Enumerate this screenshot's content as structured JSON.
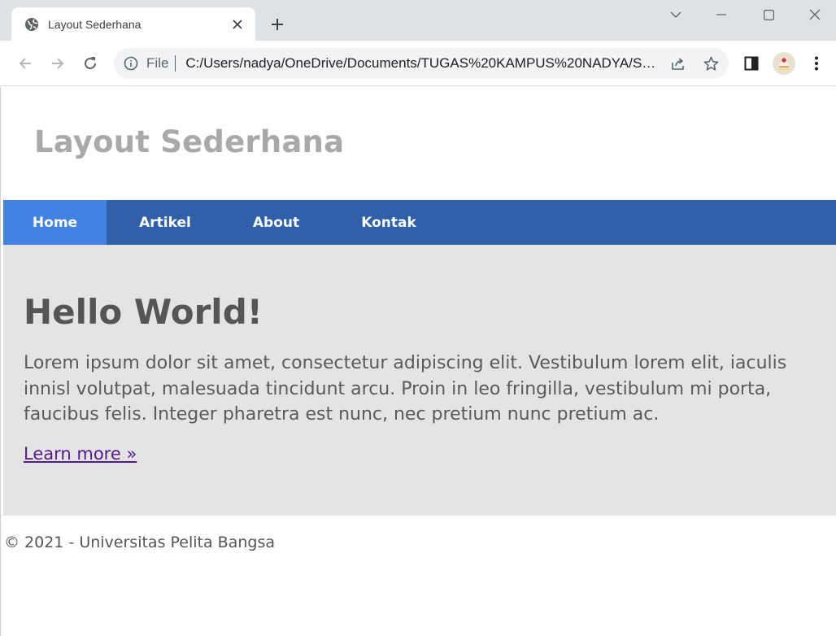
{
  "browser": {
    "tab": {
      "title": "Layout Sederhana"
    },
    "address": {
      "scheme_label": "File",
      "url": "C:/Users/nadya/OneDrive/Documents/TUGAS%20KAMPUS%20NADYA/SE..."
    },
    "icons": {
      "favicon": "globe-icon",
      "close": "close-icon",
      "new_tab": "plus-icon",
      "tab_search": "chevron-down-icon",
      "minimize": "minimize-icon",
      "maximize": "maximize-icon",
      "close_window": "close-window-icon",
      "back": "back-arrow-icon",
      "forward": "forward-arrow-icon",
      "reload": "reload-icon",
      "info": "info-icon",
      "share": "share-icon",
      "bookmark": "star-icon",
      "side_panel": "side-panel-icon",
      "profile": "avatar",
      "menu": "kebab-menu-icon"
    }
  },
  "page": {
    "header": {
      "title": "Layout Sederhana"
    },
    "nav": [
      {
        "label": "Home",
        "active": true
      },
      {
        "label": "Artikel",
        "active": false
      },
      {
        "label": "About",
        "active": false
      },
      {
        "label": "Kontak",
        "active": false
      }
    ],
    "hero": {
      "title": "Hello World!",
      "text": "Lorem ipsum dolor sit amet, consectetur adipiscing elit. Vestibulum lorem elit, iaculis innisl volutpat, malesuada tincidunt arcu. Proin in leo fringilla, vestibulum mi porta, faucibus felis. Integer pharetra est nunc, nec pretium nunc pretium ac.",
      "link": "Learn more »"
    },
    "footer": {
      "text": "© 2021 - Universitas Pelita Bangsa"
    }
  },
  "colors": {
    "nav_bg": "#3060a8",
    "nav_active": "#4282e0",
    "hero_bg": "#e4e4e4",
    "title_gray": "#a9a9a9",
    "link_visited": "#551a8b"
  }
}
